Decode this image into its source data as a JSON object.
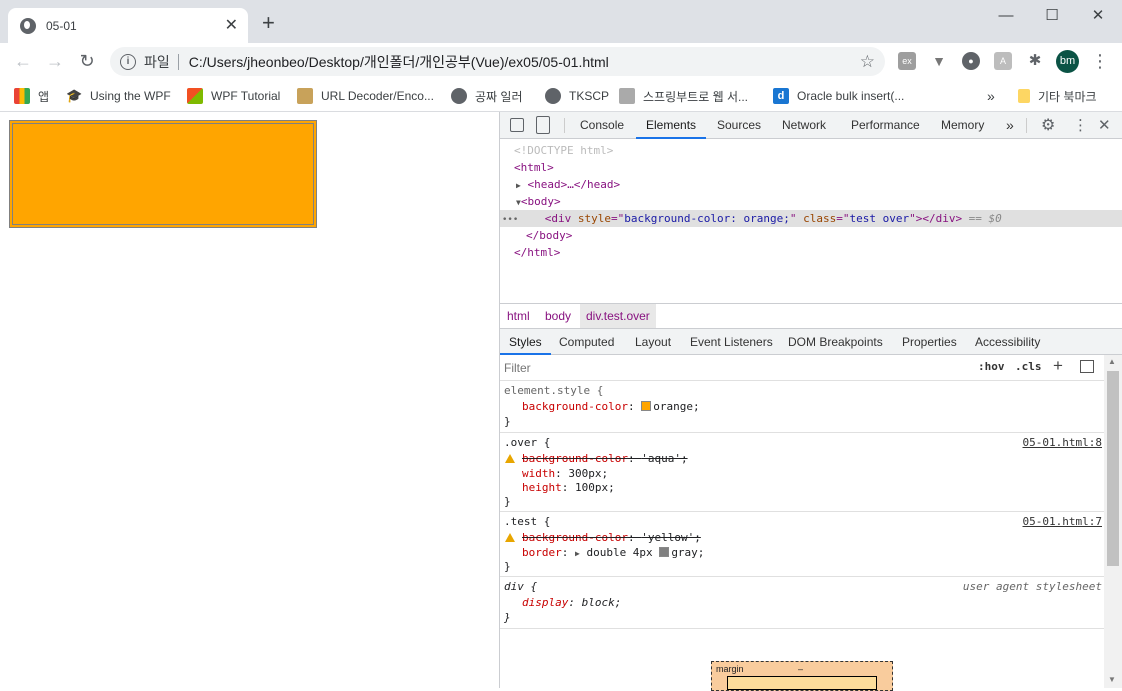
{
  "browser": {
    "tab_title": "05-01",
    "close_glyph": "✕",
    "new_tab_glyph": "+",
    "window": {
      "minimize": "—",
      "maximize": "☐",
      "close": "✕"
    },
    "address": {
      "label": "파일",
      "url": "C:/Users/jheonbeo/Desktop/개인폴더/개인공부(Vue)/ex05/05-01.html"
    },
    "avatar_text": "bm",
    "bookmarks": [
      {
        "label": "앱"
      },
      {
        "label": "Using the WPF"
      },
      {
        "label": "WPF Tutorial"
      },
      {
        "label": "URL Decoder/Enco..."
      },
      {
        "label": "공짜 일러"
      },
      {
        "label": "TKSCP"
      },
      {
        "label": "스프링부트로 웹 서..."
      },
      {
        "label": "Oracle bulk insert(..."
      }
    ],
    "bookmarks_overflow": "»",
    "other_bookmarks": "기타 북마크"
  },
  "page": {
    "box_color": "#ffa500"
  },
  "devtools": {
    "tabs": [
      "Console",
      "Elements",
      "Sources",
      "Network",
      "Performance",
      "Memory"
    ],
    "active_tab": "Elements",
    "more_tabs": "»",
    "elements": {
      "doctype": "<!DOCTYPE html>",
      "html_open": "<html>",
      "head": "<head>…</head>",
      "body_open": "<body>",
      "div_tag": "div",
      "div_style_attr": "style",
      "div_style_val": "background-color: orange;",
      "div_class_attr": "class",
      "div_class_val": "test over",
      "div_close": "></div>",
      "selected_suffix": " == $0",
      "body_close": "</body>",
      "html_close": "</html>",
      "dots": "•••"
    },
    "breadcrumbs": [
      "html",
      "body",
      "div.test.over"
    ],
    "style_tabs": [
      "Styles",
      "Computed",
      "Layout",
      "Event Listeners",
      "DOM Breakpoints",
      "Properties",
      "Accessibility"
    ],
    "filter_placeholder": "Filter",
    "hov": ":hov",
    "cls": ".cls",
    "plus": "+",
    "rules": {
      "element_style": {
        "selector": "element.style {",
        "prop": "background-color",
        "value": "orange;",
        "swatch": "#ffa500"
      },
      "over": {
        "selector": ".over {",
        "source": "05-01.html:8",
        "p1_prop": "background-color",
        "p1_val": "'aqua';",
        "p2_prop": "width",
        "p2_val": "300px;",
        "p3_prop": "height",
        "p3_val": "100px;"
      },
      "test": {
        "selector": ".test {",
        "source": "05-01.html:7",
        "p1_prop": "background-color",
        "p1_val": "'yellow';",
        "p2_prop": "border",
        "p2_val": "double 4px",
        "p2_color": "gray;",
        "swatch": "#808080"
      },
      "div": {
        "selector": "div {",
        "source": "user agent stylesheet",
        "p1_prop": "display",
        "p1_val": "block;"
      },
      "close": "}"
    },
    "box_model": {
      "label": "margin",
      "value": "–"
    }
  }
}
